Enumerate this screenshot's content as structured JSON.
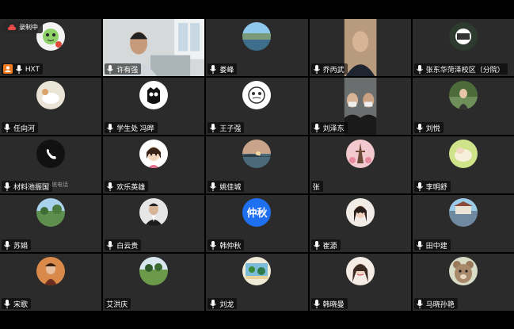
{
  "recording": {
    "label": "录制中"
  },
  "tiles": [
    {
      "name": "HXT"
    },
    {
      "name": "许有强"
    },
    {
      "name": "娄峰"
    },
    {
      "name": "乔丙武"
    },
    {
      "name": "张东华菏泽校区（分院）"
    },
    {
      "name": "任向河"
    },
    {
      "name": "学生处 冯晔"
    },
    {
      "name": "王子强"
    },
    {
      "name": "刘泽东"
    },
    {
      "name": "刘悦"
    },
    {
      "name": "材料池振国",
      "subtext": "正在接听系统电话"
    },
    {
      "name": "欢乐英雄"
    },
    {
      "name": "姚佳城"
    },
    {
      "name": "张"
    },
    {
      "name": "李明舒"
    },
    {
      "name": "苏娟"
    },
    {
      "name": "白云贵"
    },
    {
      "name": "韩仲秋",
      "avatar_text": "仲秋"
    },
    {
      "name": "崔源"
    },
    {
      "name": "田中建"
    },
    {
      "name": "宋歌"
    },
    {
      "name": "艾洪庆"
    },
    {
      "name": "刘龙"
    },
    {
      "name": "韩晓曼"
    },
    {
      "name": "马晓孙艳"
    }
  ]
}
